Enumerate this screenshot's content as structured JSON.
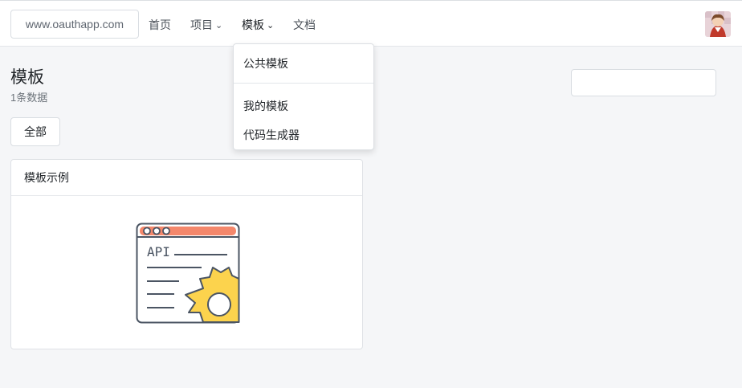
{
  "navbar": {
    "brand": "www.oauthapp.com",
    "items": [
      {
        "label": "首页"
      },
      {
        "label": "项目"
      },
      {
        "label": "模板"
      },
      {
        "label": "文档"
      }
    ],
    "dropdown_icon": "chevron-down-icon"
  },
  "dropdown": {
    "items": [
      {
        "label": "公共模板"
      },
      {
        "label": "我的模板"
      },
      {
        "label": "代码生成器"
      }
    ]
  },
  "page": {
    "title": "模板",
    "subtitle": "1条数据",
    "search_value": "",
    "filter_label": "全部"
  },
  "card": {
    "title": "模板示例",
    "illustration_text": "API",
    "icon": "api-gear-icon"
  },
  "colors": {
    "accent_orange": "#f4876b",
    "gear_yellow": "#fcd34d",
    "line_gray": "#4b5563"
  }
}
